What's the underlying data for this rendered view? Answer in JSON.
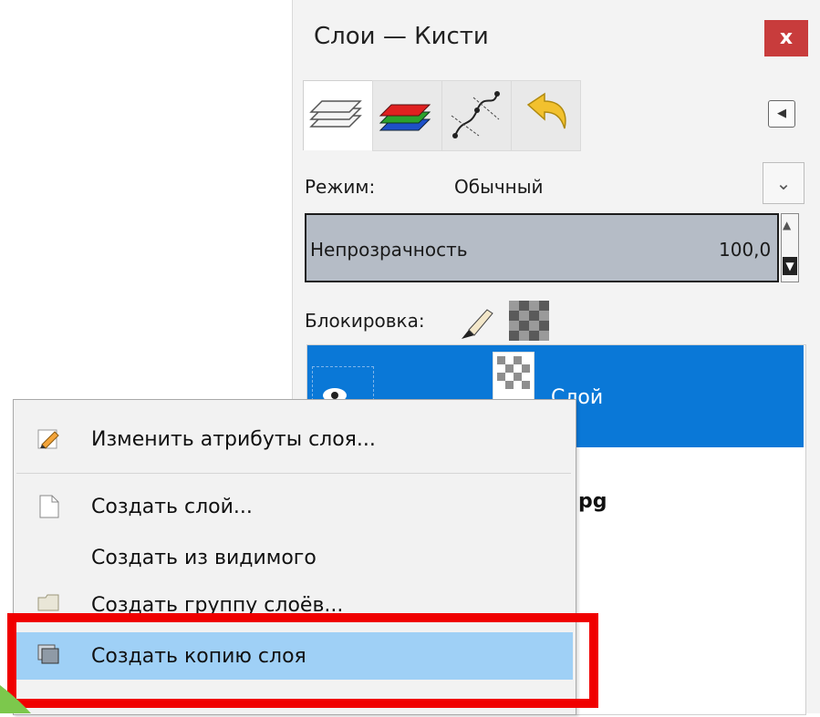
{
  "dock": {
    "title": "Слои — Кисти",
    "close_label": "x",
    "tabs": [
      {
        "name": "layers-tab-icon"
      },
      {
        "name": "channels-tab-icon"
      },
      {
        "name": "paths-tab-icon"
      },
      {
        "name": "undo-history-tab-icon"
      }
    ],
    "mode": {
      "label": "Режим:",
      "value": "Обычный"
    },
    "opacity": {
      "label": "Непрозрачность",
      "value": "100,0"
    },
    "lock": {
      "label": "Блокировка:"
    },
    "layers": [
      {
        "name": "Слой",
        "selected": true
      },
      {
        "name": "pg",
        "selected": false
      }
    ]
  },
  "context_menu": {
    "items": [
      {
        "label": "Изменить атрибуты слоя..."
      },
      {
        "label": "Создать слой..."
      },
      {
        "label": "Создать из видимого"
      },
      {
        "label": "Создать группу слоёв..."
      },
      {
        "label": "Создать копию слоя",
        "highlighted": true
      }
    ]
  },
  "colors": {
    "selection_blue": "#0a78d7",
    "menu_highlight": "#9fd0f6",
    "annotation_red": "#f00000",
    "close_red": "#c83c3c"
  }
}
